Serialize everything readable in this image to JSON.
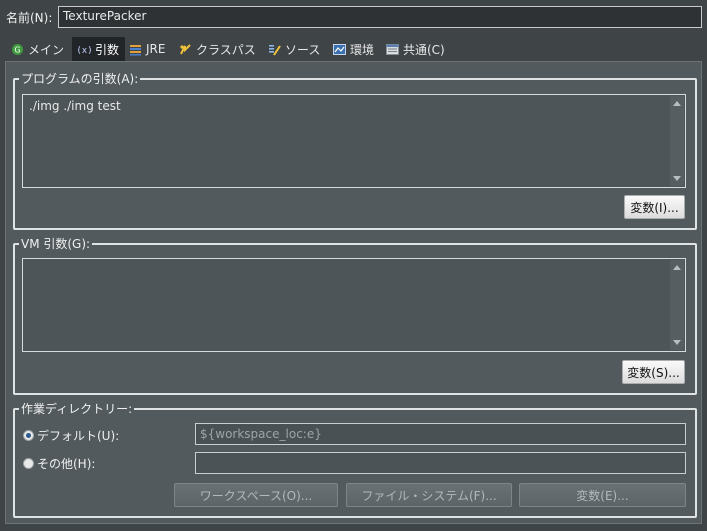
{
  "name_row": {
    "label": "名前(N):",
    "value": "TexturePacker"
  },
  "tabs": [
    {
      "label": "メイン",
      "icon": "main-icon"
    },
    {
      "label": "引数",
      "icon": "arguments-icon",
      "active": true
    },
    {
      "label": "JRE",
      "icon": "jre-icon"
    },
    {
      "label": "クラスパス",
      "icon": "classpath-icon"
    },
    {
      "label": "ソース",
      "icon": "source-icon"
    },
    {
      "label": "環境",
      "icon": "environment-icon"
    },
    {
      "label": "共通(C)",
      "icon": "common-icon"
    }
  ],
  "program_args": {
    "legend": "プログラムの引数(A):",
    "value": "./img ./img test",
    "variables_button": "変数(I)..."
  },
  "vm_args": {
    "legend": "VM 引数(G):",
    "value": "",
    "variables_button": "変数(S)..."
  },
  "working_dir": {
    "legend": "作業ディレクトリー:",
    "default_label": "デフォルト(U):",
    "default_value": "${workspace_loc:e}",
    "other_label": "その他(H):",
    "other_value": "",
    "workspace_button": "ワークスペース(O)...",
    "filesystem_button": "ファイル・システム(F)...",
    "variables_button": "変数(E)..."
  },
  "colors": {
    "accent_active_tab": "#222528",
    "panel": "#525a5d",
    "background": "#3f4447"
  }
}
